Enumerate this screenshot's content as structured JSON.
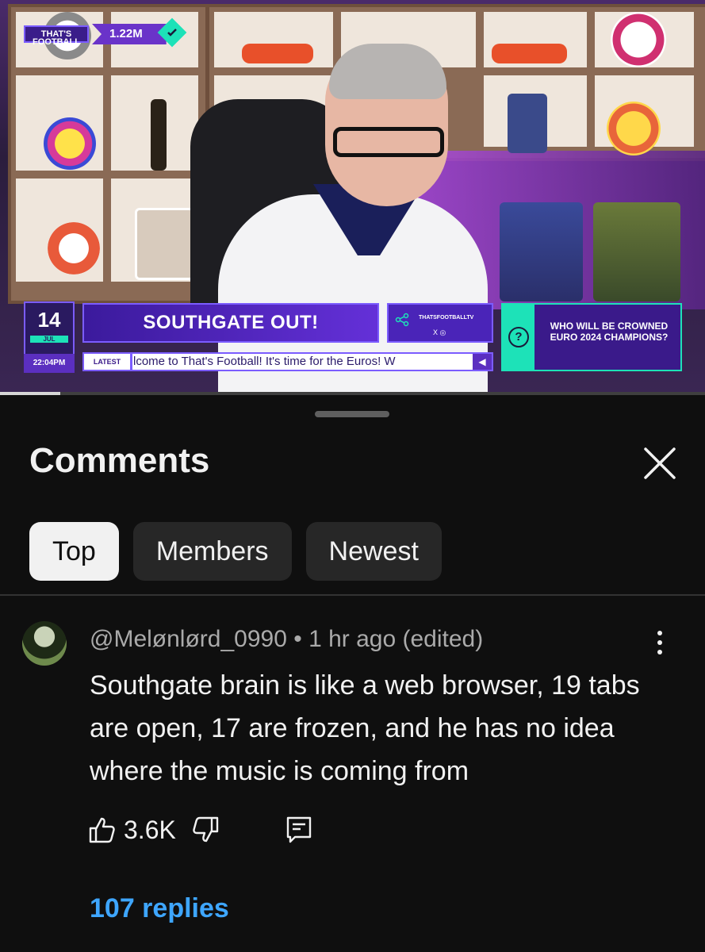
{
  "video": {
    "channel_logo_text": "THAT'S FOOTBALL",
    "subscriber_count": "1.22M",
    "date_day": "14",
    "date_month": "JUL",
    "time": "22:04PM",
    "headline": "SOUTHGATE OUT!",
    "social_handle": "THATSFOOTBALLTV",
    "social_icons": "X  ◎",
    "poll_question": "WHO WILL BE CROWNED EURO 2024 CHAMPIONS?",
    "ticker_label": "LATEST",
    "ticker_text": "lcome to That's Football! It's time for the Euros! W",
    "progress": 0.085
  },
  "comments_panel": {
    "title": "Comments",
    "chips": [
      {
        "label": "Top",
        "active": true
      },
      {
        "label": "Members",
        "active": false
      },
      {
        "label": "Newest",
        "active": false
      }
    ]
  },
  "comment": {
    "meta": "@Melønlørd_0990 • 1 hr ago (edited)",
    "text": "Southgate brain is like a web browser, 19 tabs are open, 17 are frozen, and he has no idea where the music is coming from",
    "like_count": "3.6K",
    "replies_label": "107 replies"
  },
  "icons": {
    "close": "close-icon",
    "more": "more-vert-icon",
    "like": "thumb-up-icon",
    "dislike": "thumb-down-icon",
    "reply": "reply-icon"
  }
}
